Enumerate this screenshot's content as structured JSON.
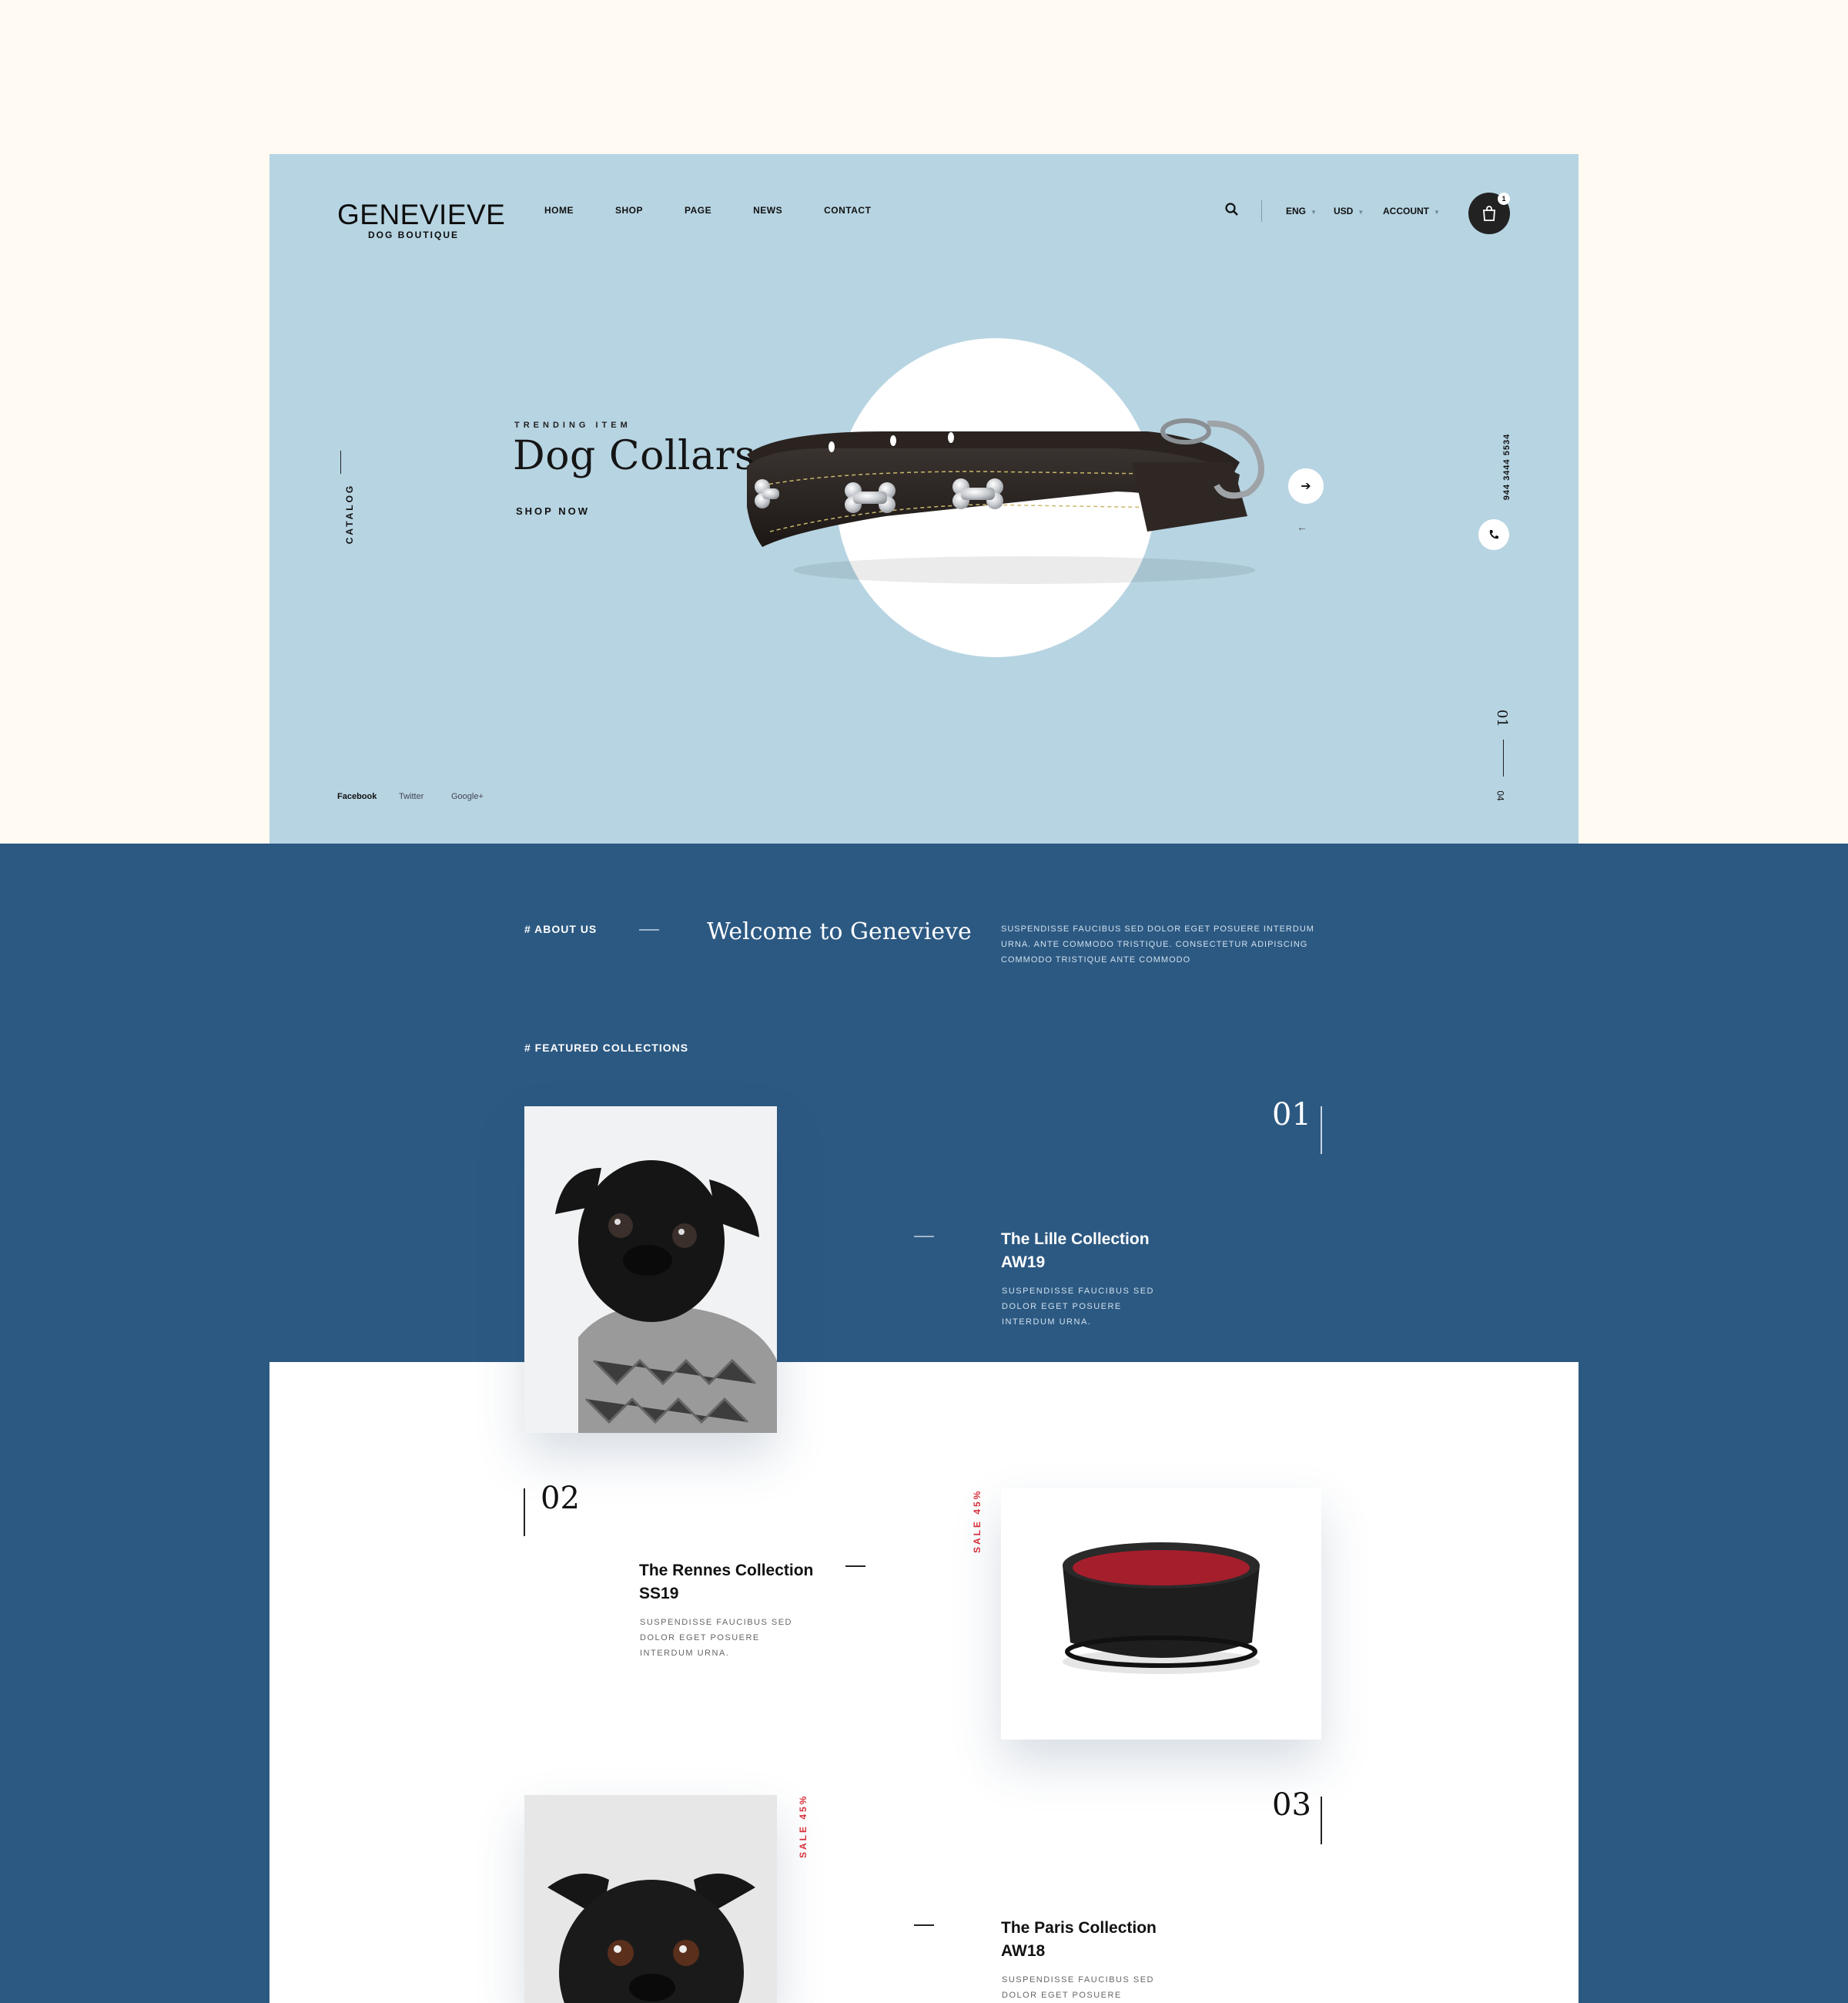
{
  "brand": {
    "name": "GENEVIEVE",
    "tagline": "DOG BOUTIQUE"
  },
  "nav": [
    "HOME",
    "SHOP",
    "PAGE",
    "NEWS",
    "CONTACT"
  ],
  "header": {
    "language": "ENG",
    "currency": "USD",
    "account": "ACCOUNT",
    "cart_count": "1"
  },
  "hero": {
    "catalog": "CATALOG",
    "eyebrow": "TRENDING ITEM",
    "title": "Dog Collars",
    "cta": "SHOP NOW",
    "phone": "944 3444 5534",
    "slide_current": "01",
    "slide_total": "04"
  },
  "social": [
    "Facebook",
    "Twitter",
    "Google+"
  ],
  "about": {
    "label": "# ABOUT US",
    "title": "Welcome to Genevieve",
    "text": "SUSPENDISSE FAUCIBUS SED DOLOR EGET POSUERE INTERDUM URNA. ANTE COMMODO TRISTIQUE. CONSECTETUR ADIPISCING COMMODO TRISTIQUE ANTE COMMODO"
  },
  "featured": {
    "label": "# FEATURED COLLECTIONS",
    "collections": [
      {
        "number": "01",
        "title_line1": "The Lille Collection",
        "title_line2": "AW19",
        "text": "SUSPENDISSE FAUCIBUS SED DOLOR EGET POSUERE INTERDUM URNA."
      },
      {
        "number": "02",
        "title_line1": "The Rennes Collection",
        "title_line2": "SS19",
        "text": "SUSPENDISSE FAUCIBUS SED DOLOR EGET POSUERE INTERDUM URNA.",
        "sale": "SALE 45%"
      },
      {
        "number": "03",
        "title_line1": "The Paris Collection",
        "title_line2": "AW18",
        "text": "SUSPENDISSE FAUCIBUS SED DOLOR EGET POSUERE INTERDUM",
        "sale": "SALE 45%"
      }
    ]
  },
  "colors": {
    "page_bg": "#fffbf2",
    "hero_bg": "#b7d4e2",
    "blue_section": "#2c5982",
    "sale_red": "#d8303a"
  }
}
